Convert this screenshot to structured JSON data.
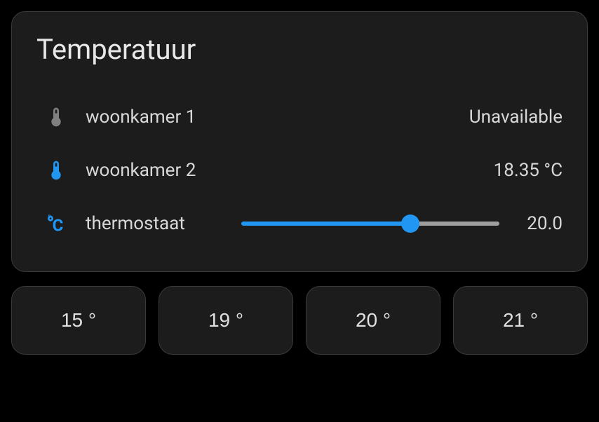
{
  "card": {
    "title": "Temperatuur",
    "entities": [
      {
        "icon": "thermometer",
        "iconColor": "gray",
        "name": "woonkamer 1",
        "value": "Unavailable"
      },
      {
        "icon": "thermometer",
        "iconColor": "blue",
        "name": "woonkamer 2",
        "value": "18.35 °C"
      }
    ],
    "thermostat": {
      "icon": "celsius",
      "iconColor": "blue",
      "name": "thermostaat",
      "value": "20.0",
      "sliderMin": 15,
      "sliderMax": 22.5,
      "sliderValue": 20
    }
  },
  "presets": [
    {
      "label": "15 °"
    },
    {
      "label": "19 °"
    },
    {
      "label": "20 °"
    },
    {
      "label": "21 °"
    }
  ]
}
